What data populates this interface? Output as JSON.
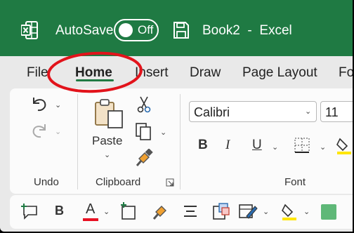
{
  "title_bar": {
    "autosave_label": "AutoSave",
    "autosave_state": "Off",
    "document_title": "Book2  -  Excel",
    "brand_color": "#1f7a43"
  },
  "tabs": [
    {
      "label": "File"
    },
    {
      "label": "Home",
      "active": true
    },
    {
      "label": "Insert"
    },
    {
      "label": "Draw"
    },
    {
      "label": "Page Layout"
    },
    {
      "label": "Fo"
    }
  ],
  "ribbon": {
    "undo_group_label": "Undo",
    "clipboard": {
      "paste_label": "Paste",
      "group_label": "Clipboard"
    },
    "font": {
      "font_name": "Calibri",
      "font_size": "11",
      "group_label": "Font",
      "bold": "B",
      "italic": "I",
      "underline": "U"
    }
  },
  "quick_toolbar": {
    "bold": "B",
    "font_color_letter": "A",
    "font_color": "#e81123",
    "highlight_color": "#ffe600",
    "swatch_color": "#5fb878"
  },
  "annotation_color": "#e2131b"
}
